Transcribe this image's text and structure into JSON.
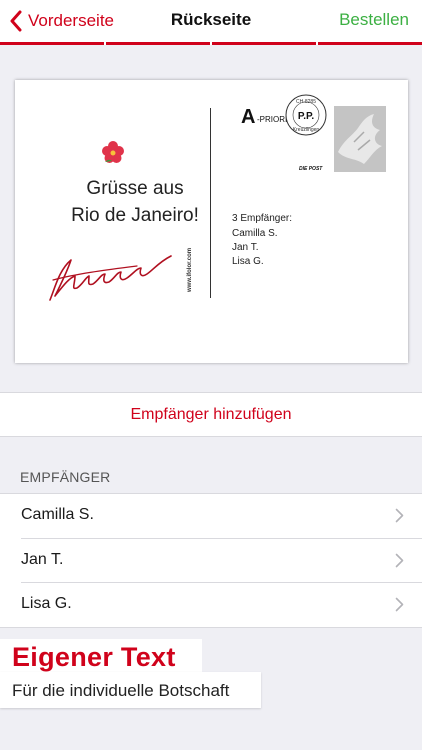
{
  "nav": {
    "back_label": "Vorderseite",
    "title": "Rückseite",
    "action_label": "Bestellen",
    "accent": "#d0021b",
    "action_color": "#3cb043"
  },
  "postcard": {
    "greeting_line1": "Grüsse aus",
    "greeting_line2": "Rio de Janeiro!",
    "vertical_text": "www.ifolor.com",
    "priority_letter": "A",
    "priority_word": "-PRIORITY",
    "pp_stamp_top": "CH-8285",
    "pp_stamp_mid": "P.P.",
    "pp_stamp_bottom": "Kreuzlingen",
    "post_logo": "DIE POST",
    "address_lines": [
      "3 Empfänger:",
      "Camilla S.",
      "Jan T.",
      "Lisa G."
    ]
  },
  "add_recipient": {
    "label": "Empfänger hinzufügen"
  },
  "recipients": {
    "header": "EMPFÄNGER",
    "items": [
      {
        "name": "Camilla S."
      },
      {
        "name": "Jan T."
      },
      {
        "name": "Lisa G."
      }
    ]
  },
  "promo": {
    "title": "Eigener Text",
    "subtitle": "Für die individuelle Botschaft"
  },
  "icons": {
    "back": "chevron-left-icon",
    "row": "chevron-right-icon",
    "flower": "flower-icon"
  }
}
